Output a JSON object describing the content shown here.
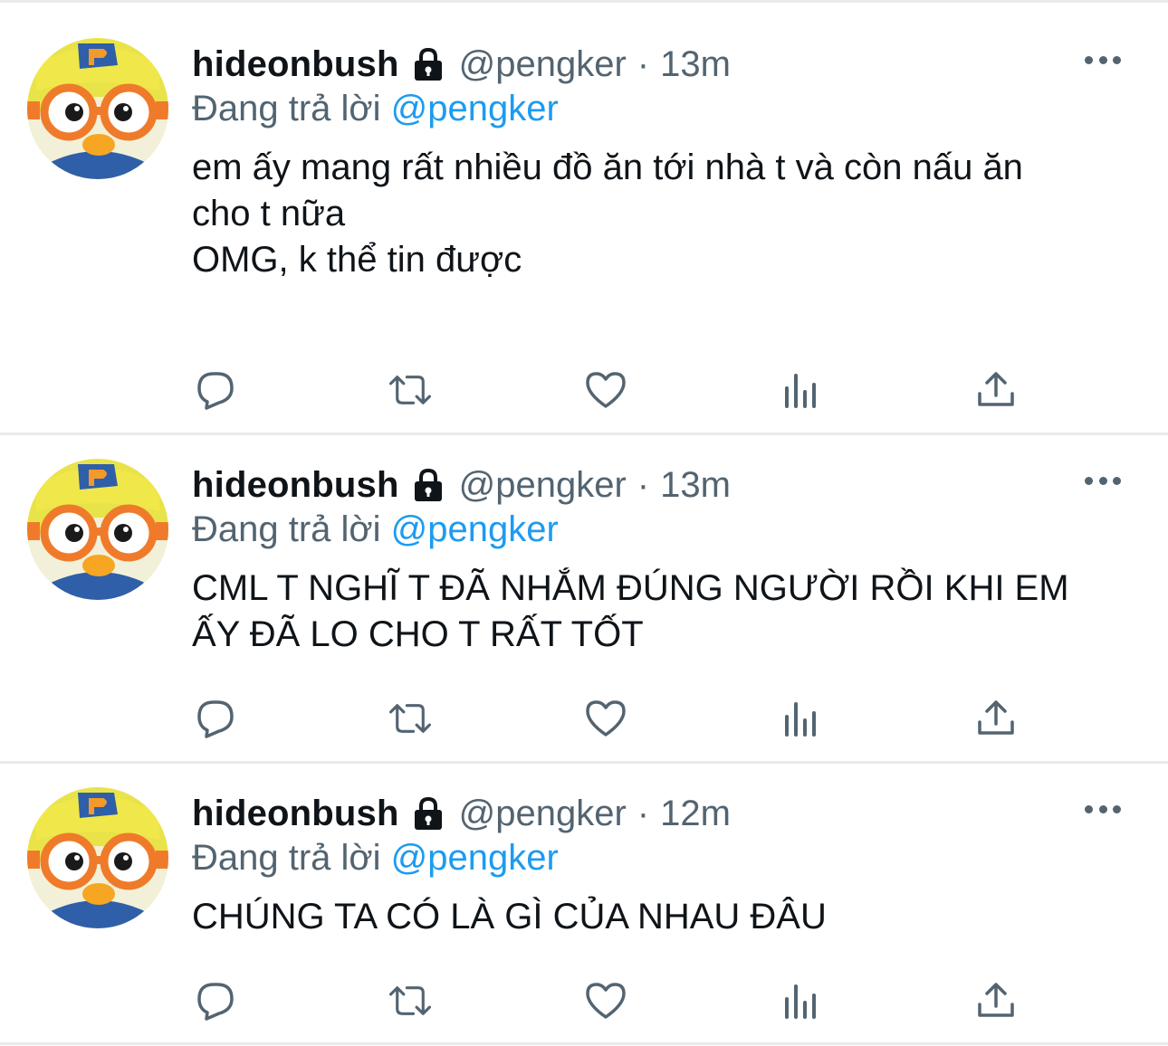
{
  "colors": {
    "text": "#0f1419",
    "secondary": "#536471",
    "link": "#1d9bf0",
    "separator": "#e8ebed"
  },
  "icons": {
    "avatar": "porong-avatar",
    "lock": "lock-icon",
    "more": "more-icon",
    "reply": "reply-icon",
    "retweet": "retweet-icon",
    "like": "heart-icon",
    "analytics": "analytics-icon",
    "share": "share-icon"
  },
  "tweets": [
    {
      "name": "hideonbush",
      "handle": "@pengker",
      "dot": "·",
      "time": "13m",
      "reply_prefix": "Đang trả lời",
      "reply_to": "@pengker",
      "lines": [
        "em ấy mang rất nhiều đồ ăn tới nhà t và còn nấu ăn",
        "cho t nữa",
        "OMG, k thể tin được"
      ]
    },
    {
      "name": "hideonbush",
      "handle": "@pengker",
      "dot": "·",
      "time": "13m",
      "reply_prefix": "Đang trả lời",
      "reply_to": "@pengker",
      "lines": [
        "CML T NGHĨ T ĐÃ NHẮM ĐÚNG NGƯỜI RỒI KHI EM",
        "ẤY ĐÃ LO CHO T RẤT TỐT"
      ]
    },
    {
      "name": "hideonbush",
      "handle": "@pengker",
      "dot": "·",
      "time": "12m",
      "reply_prefix": "Đang trả lời",
      "reply_to": "@pengker",
      "lines": [
        "CHÚNG TA CÓ LÀ GÌ CỦA NHAU ĐÂU"
      ]
    }
  ]
}
